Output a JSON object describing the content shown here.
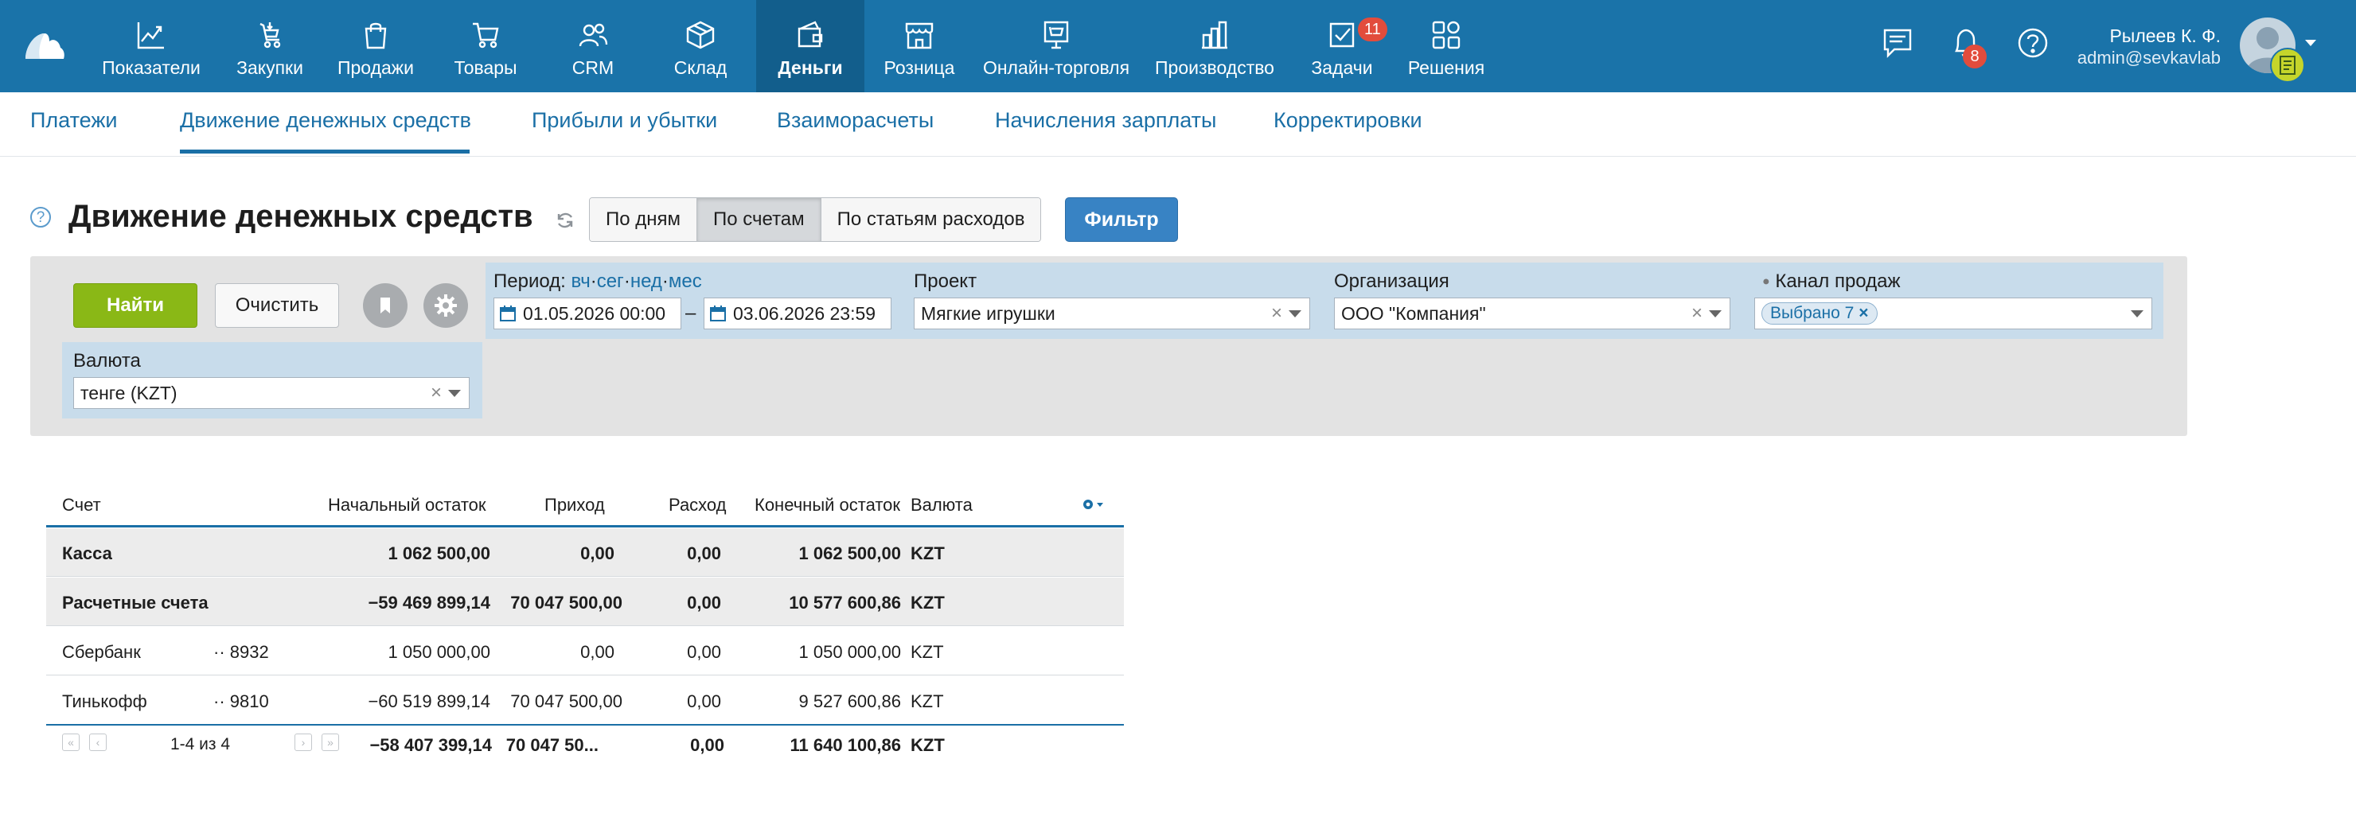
{
  "nav": {
    "items": [
      {
        "label": "Показатели",
        "icon": "chart-line-icon"
      },
      {
        "label": "Закупки",
        "icon": "purchases-icon"
      },
      {
        "label": "Продажи",
        "icon": "shopping-bag-icon"
      },
      {
        "label": "Товары",
        "icon": "cart-icon"
      },
      {
        "label": "CRM",
        "icon": "people-icon"
      },
      {
        "label": "Склад",
        "icon": "box-icon"
      },
      {
        "label": "Деньги",
        "icon": "wallet-icon"
      },
      {
        "label": "Розница",
        "icon": "storefront-icon"
      },
      {
        "label": "Онлайн-торговля",
        "icon": "online-shop-icon"
      },
      {
        "label": "Производство",
        "icon": "production-icon"
      },
      {
        "label": "Задачи",
        "icon": "tasks-icon",
        "badge": "11"
      },
      {
        "label": "Решения",
        "icon": "apps-icon"
      }
    ],
    "active_index": 6,
    "notifications_badge": "8",
    "user_name": "Рылеев К. Ф.",
    "user_email": "admin@sevkavlab"
  },
  "subnav": {
    "tabs": [
      "Платежи",
      "Движение денежных средств",
      "Прибыли и убытки",
      "Взаиморасчеты",
      "Начисления зарплаты",
      "Корректировки"
    ],
    "active_index": 1
  },
  "page": {
    "title": "Движение денежных средств",
    "help": "?",
    "views": [
      "По дням",
      "По счетам",
      "По статьям расходов"
    ],
    "active_view": 1,
    "filter_label": "Фильтр"
  },
  "filter": {
    "find_label": "Найти",
    "clear_label": "Очистить",
    "period_label": "Период:",
    "period_links": [
      "вч",
      "сег",
      "нед",
      "мес"
    ],
    "date_from": "01.05.2026 00:00",
    "date_sep": "–",
    "date_to": "03.06.2026 23:59",
    "project_label": "Проект",
    "project_value": "Мягкие игрушки",
    "org_label": "Организация",
    "org_value": "ООО \"Компания\"",
    "channel_label": "Канал продаж",
    "channel_chip": "Выбрано 7",
    "currency_label": "Валюта",
    "currency_value": "тенге (KZT)",
    "clear_x": "×"
  },
  "table": {
    "headers": [
      "Счет",
      "Начальный остаток",
      "Приход",
      "Расход",
      "Конечный остаток",
      "Валюта"
    ],
    "rows": [
      {
        "type": "group",
        "name": "Касса",
        "num": "",
        "start": "1 062 500,00",
        "in": "0,00",
        "out": "0,00",
        "end": "1 062 500,00",
        "cur": "KZT"
      },
      {
        "type": "group",
        "name": "Расчетные счета",
        "num": "",
        "start": "−59 469 899,14",
        "in": "70 047 500,00",
        "out": "0,00",
        "end": "10 577 600,86",
        "cur": "KZT"
      },
      {
        "type": "item",
        "name": "Сбербанк",
        "num": "·· 8932",
        "start": "1 050 000,00",
        "in": "0,00",
        "out": "0,00",
        "end": "1 050 000,00",
        "cur": "KZT"
      },
      {
        "type": "item",
        "name": "Тинькофф",
        "num": "·· 9810",
        "start": "−60 519 899,14",
        "in": "70 047 500,00",
        "out": "0,00",
        "end": "9 527 600,86",
        "cur": "KZT"
      }
    ],
    "footer": {
      "start": "−58 407 399,14",
      "in": "70 047 50...",
      "out": "0,00",
      "end": "11 640 100,86",
      "cur": "KZT"
    },
    "pagination": "1-4 из 4"
  },
  "colors": {
    "topbar": "#1a73a9",
    "active_nav": "#125e8c",
    "accent": "#1a6fa6",
    "find": "#8ab816",
    "badge": "#e24c3c"
  }
}
